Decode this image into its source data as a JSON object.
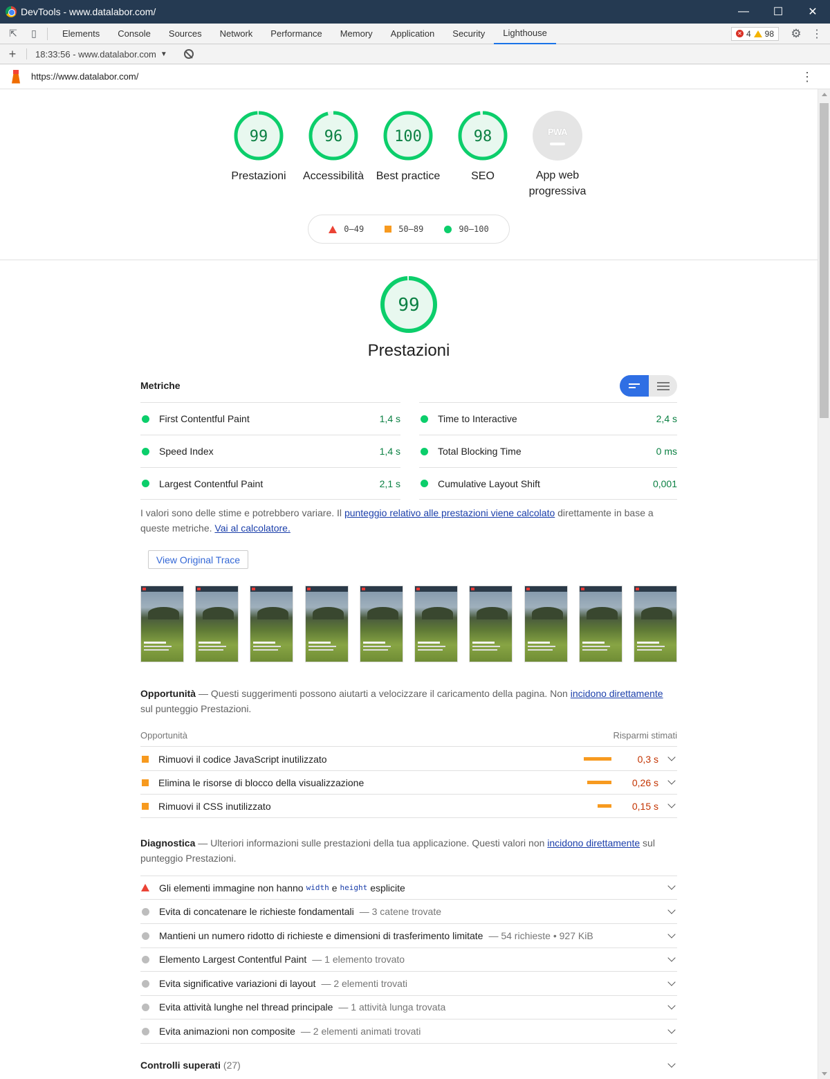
{
  "window": {
    "title": "DevTools - www.datalabor.com/"
  },
  "tabs": [
    "Elements",
    "Console",
    "Sources",
    "Network",
    "Performance",
    "Memory",
    "Application",
    "Security",
    "Lighthouse"
  ],
  "active_tab": "Lighthouse",
  "issues": {
    "errors": "4",
    "warnings": "98"
  },
  "report_selector": {
    "value": "18:33:56 - www.datalabor.com"
  },
  "url": "https://www.datalabor.com/",
  "gauges": [
    {
      "score": "99",
      "label": "Prestazioni",
      "progress": 0.99
    },
    {
      "score": "96",
      "label": "Accessibilità",
      "progress": 0.96
    },
    {
      "score": "100",
      "label": "Best practice",
      "progress": 1.0
    },
    {
      "score": "98",
      "label": "SEO",
      "progress": 0.98
    }
  ],
  "pwa": {
    "badge": "PWA",
    "label_line1": "App web",
    "label_line2": "progressiva"
  },
  "legend": {
    "fail": "0–49",
    "average": "50–89",
    "pass": "90–100"
  },
  "performance": {
    "score": "99",
    "progress": 0.99,
    "title": "Prestazioni",
    "metrics_title": "Metriche",
    "metrics_left": [
      {
        "name": "First Contentful Paint",
        "value": "1,4 s"
      },
      {
        "name": "Speed Index",
        "value": "1,4 s"
      },
      {
        "name": "Largest Contentful Paint",
        "value": "2,1 s"
      }
    ],
    "metrics_right": [
      {
        "name": "Time to Interactive",
        "value": "2,4 s"
      },
      {
        "name": "Total Blocking Time",
        "value": "0 ms"
      },
      {
        "name": "Cumulative Layout Shift",
        "value": "0,001"
      }
    ],
    "note_text1": "I valori sono delle stime e potrebbero variare. Il ",
    "note_link1": "punteggio relativo alle prestazioni viene calcolato",
    "note_text2": " direttamente in base a queste metriche. ",
    "note_link2": "Vai al calcolatore.",
    "trace_button": "View Original Trace"
  },
  "opportunities": {
    "title": "Opportunità",
    "desc1": " — Questi suggerimenti possono aiutarti a velocizzare il caricamento della pagina. Non ",
    "link": "incidono direttamente",
    "desc2": " sul punteggio Prestazioni.",
    "col_left": "Opportunità",
    "col_right": "Risparmi stimati",
    "items": [
      {
        "title": "Rimuovi il codice JavaScript inutilizzato",
        "saving": "0,3 s",
        "fraction": 1.0
      },
      {
        "title": "Elimina le risorse di blocco della visualizzazione",
        "saving": "0,26 s",
        "fraction": 0.87
      },
      {
        "title": "Rimuovi il CSS inutilizzato",
        "saving": "0,15 s",
        "fraction": 0.5
      }
    ]
  },
  "diagnostics": {
    "title": "Diagnostica",
    "desc1": " — Ulteriori informazioni sulle prestazioni della tua applicazione. Questi valori non ",
    "link": "incidono direttamente",
    "desc2": " sul punteggio Prestazioni.",
    "first_item": {
      "pre": "Gli elementi immagine non hanno",
      "code1": "width",
      "mid": "e",
      "code2": "height",
      "post": "esplicite"
    },
    "items": [
      {
        "title": "Evita di concatenare le richieste fondamentali",
        "detail": "— 3 catene trovate"
      },
      {
        "title": "Mantieni un numero ridotto di richieste e dimensioni di trasferimento limitate",
        "detail": "— 54 richieste • 927 KiB"
      },
      {
        "title": "Elemento Largest Contentful Paint",
        "detail": "— 1 elemento trovato"
      },
      {
        "title": "Evita significative variazioni di layout",
        "detail": "— 2 elementi trovati"
      },
      {
        "title": "Evita attività lunghe nel thread principale",
        "detail": "— 1 attività lunga trovata"
      },
      {
        "title": "Evita animazioni non composite",
        "detail": "— 2 elementi animati trovati"
      }
    ]
  },
  "passed": {
    "title": "Controlli superati",
    "count": "(27)"
  },
  "colors": {
    "pass": "#0cce6b",
    "pass_text": "#0b8043",
    "average": "#f79a1f",
    "fail": "#eb4335",
    "accent": "#1a73e8",
    "titlebar": "#253a52"
  }
}
